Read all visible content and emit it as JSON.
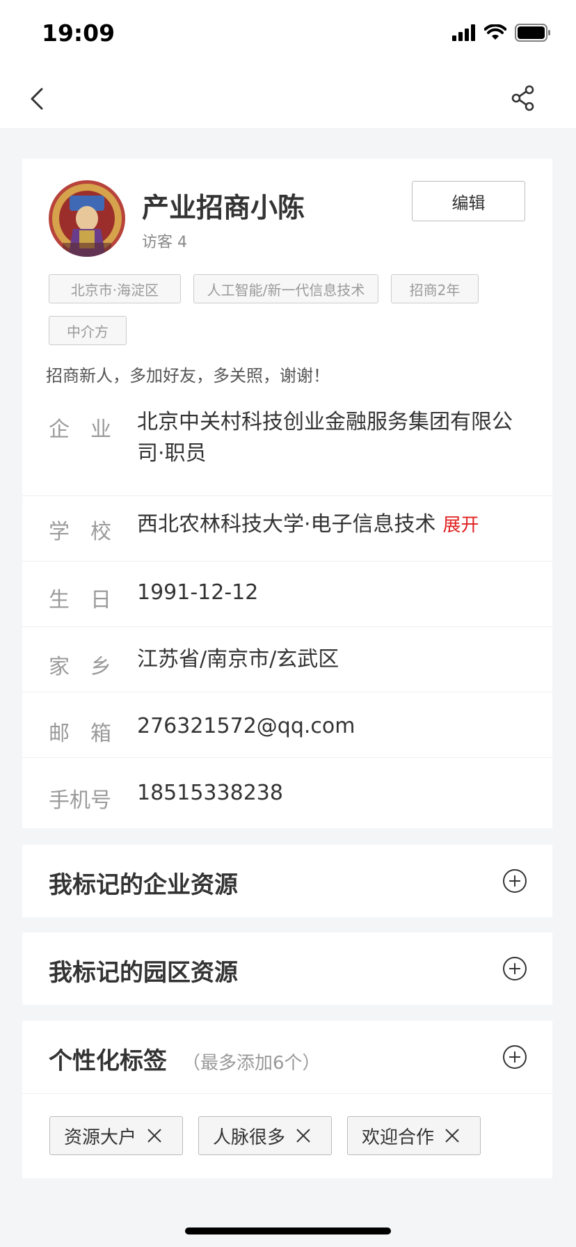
{
  "status_bar": {
    "time": "19:09"
  },
  "profile": {
    "name": "产业招商小陈",
    "visitors": "访客 4",
    "edit_label": "编辑",
    "tags": [
      "北京市·海淀区",
      "人工智能/新一代信息技术",
      "招商2年",
      "中介方"
    ],
    "intro": "招商新人，多加好友，多关照，谢谢！",
    "info": [
      {
        "label": "企　业",
        "value": "北京中关村科技创业金融服务集团有限公司·职员"
      },
      {
        "label": "学　校",
        "value": "西北农林科技大学·电子信息技术",
        "action": "展开"
      },
      {
        "label": "生　日",
        "value": "1991-12-12"
      },
      {
        "label": "家　乡",
        "value": "江苏省/南京市/玄武区"
      },
      {
        "label": "邮　箱",
        "value": "276321572@qq.com"
      },
      {
        "label": "手机号",
        "value": "18515338238"
      }
    ]
  },
  "sections": {
    "company_resources": "我标记的企业资源",
    "park_resources": "我标记的园区资源",
    "personal_tags": {
      "title": "个性化标签",
      "hint": "（最多添加6个）"
    }
  },
  "personal_tags": [
    "资源大户",
    "人脉很多",
    "欢迎合作"
  ],
  "colors": {
    "accent_red": "#e02020",
    "background": "#f4f5f7"
  }
}
